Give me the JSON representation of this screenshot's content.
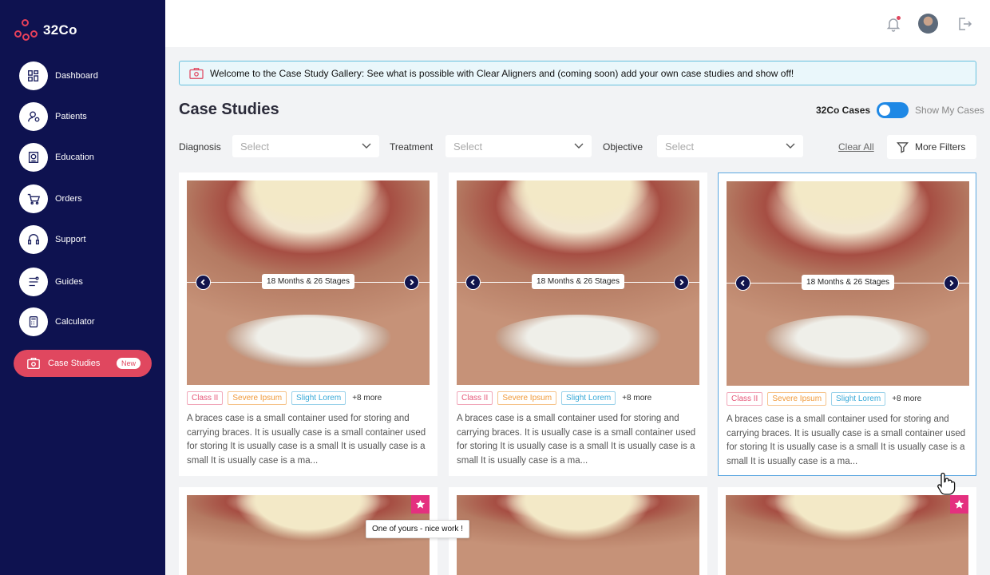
{
  "app": {
    "logo_text": "32Co"
  },
  "sidebar": {
    "items": [
      {
        "label": "Dashboard"
      },
      {
        "label": "Patients"
      },
      {
        "label": "Education"
      },
      {
        "label": "Orders"
      },
      {
        "label": "Support"
      },
      {
        "label": "Guides"
      },
      {
        "label": "Calculator"
      }
    ],
    "active": {
      "label": "Case Studies",
      "badge": "New"
    }
  },
  "banner": {
    "text": "Welcome to the Case Study Gallery: See what is possible with Clear Aligners and (coming soon) add your own case studies and show off!"
  },
  "page": {
    "title": "Case Studies",
    "toggle": {
      "on_label": "32Co Cases",
      "off_label": "Show My Cases"
    }
  },
  "filters": {
    "diagnosis": {
      "label": "Diagnosis",
      "placeholder": "Select"
    },
    "treatment": {
      "label": "Treatment",
      "placeholder": "Select"
    },
    "objective": {
      "label": "Objective",
      "placeholder": "Select"
    },
    "clear_all": "Clear All",
    "more_filters": "More Filters"
  },
  "cards": [
    {
      "stage": "18 Months & 26 Stages",
      "tags": [
        "Class II",
        "Severe Ipsum",
        "Slight Lorem"
      ],
      "more": "+8 more",
      "description": "A braces case is a small container used for storing and carrying braces. It is usually case is a small container used for storing It is usually case is a small It is usually case is a small It is usually case is a ma..."
    },
    {
      "stage": "18 Months & 26 Stages",
      "tags": [
        "Class II",
        "Severe Ipsum",
        "Slight Lorem"
      ],
      "more": "+8 more",
      "description": "A braces case is a small container used for storing and carrying braces. It is usually case is a small container used for storing It is usually case is a small It is usually case is a small It is usually case is a ma..."
    },
    {
      "stage": "18 Months & 26 Stages",
      "tags": [
        "Class II",
        "Severe Ipsum",
        "Slight Lorem"
      ],
      "more": "+8 more",
      "description": "A braces case is a small container used for storing and carrying braces. It is usually case is a small container used for storing It is usually case is a small It is usually case is a small It is usually case is a ma..."
    }
  ],
  "tooltip": "One of yours - nice work !",
  "colors": {
    "sidebar": "#0e1250",
    "accent": "#e0475f",
    "toggle": "#1e88e5",
    "star": "#e4307f"
  }
}
